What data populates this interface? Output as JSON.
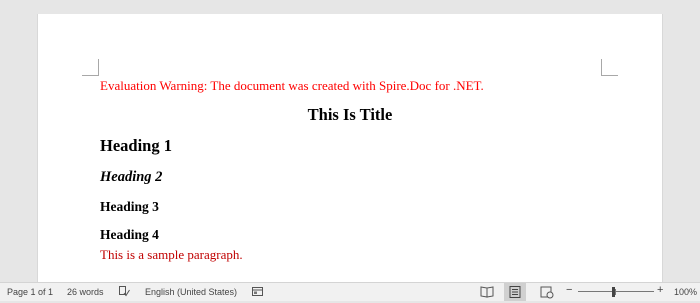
{
  "document": {
    "warning": "Evaluation Warning: The document was created with Spire.Doc for .NET.",
    "title": "This Is Title",
    "heading1": "Heading 1",
    "heading2": "Heading 2",
    "heading3": "Heading 3",
    "heading4": "Heading 4",
    "paragraph": "This is a sample paragraph."
  },
  "statusbar": {
    "page": "Page 1 of 1",
    "words": "26 words",
    "language": "English (United States)",
    "zoom_minus": "−",
    "zoom_plus": "+",
    "zoom": "100%"
  },
  "colors": {
    "warning": "#ff0000",
    "paragraph": "#c00000"
  },
  "icons": [
    "proofing-icon",
    "macro-icon",
    "read-mode-icon",
    "print-layout-icon",
    "web-layout-icon"
  ]
}
